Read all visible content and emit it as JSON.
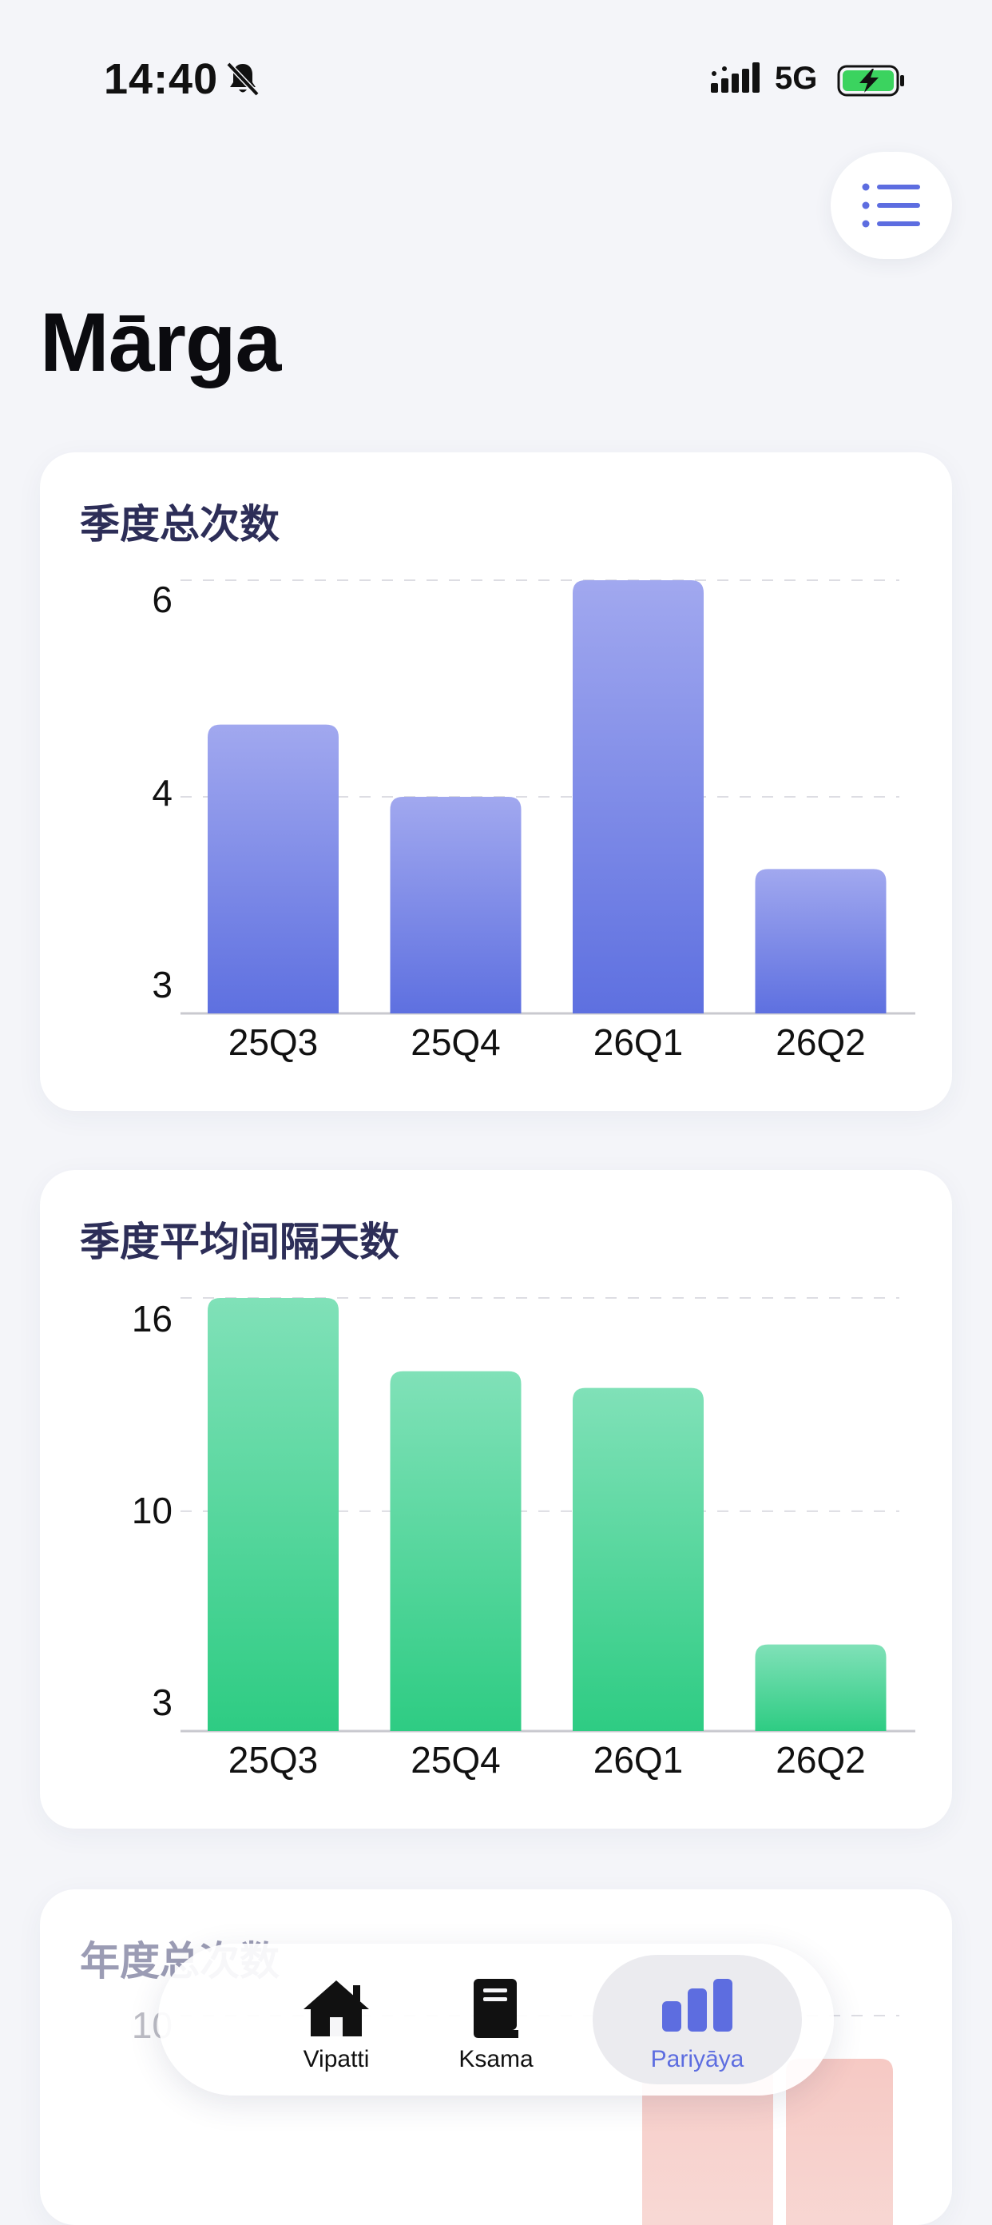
{
  "status_bar": {
    "time": "14:40",
    "network": "5G",
    "bell_icon": "bell-slash-icon",
    "signal_icon": "cellular-signal-icon",
    "battery_icon": "battery-charging-icon"
  },
  "header": {
    "menu_icon": "list-icon",
    "title": "Mārga"
  },
  "colors": {
    "accent": "#5d6de0",
    "purple_top": "#a1a8ef",
    "purple_bottom": "#5e70e0",
    "green_top": "#80e1b8",
    "green_bottom": "#2ecc83",
    "red_faint": "#f6c9c4"
  },
  "cards": [
    {
      "title": "季度总次数"
    },
    {
      "title": "季度平均间隔天数"
    },
    {
      "title": "年度总次数"
    }
  ],
  "chart_data": [
    {
      "type": "bar",
      "title": "季度总次数",
      "categories": [
        "25Q3",
        "25Q4",
        "26Q1",
        "26Q2"
      ],
      "values": [
        5,
        4.5,
        6,
        4
      ],
      "y_ticks": [
        "6",
        "4",
        "3"
      ],
      "y_tick_values": [
        6,
        4,
        3
      ],
      "ylim": [
        3,
        6
      ],
      "grid": "dashed horizontal",
      "color": "purple gradient"
    },
    {
      "type": "bar",
      "title": "季度平均间隔天数",
      "categories": [
        "25Q3",
        "25Q4",
        "26Q1",
        "26Q2"
      ],
      "values": [
        16,
        13.8,
        13.3,
        5.6
      ],
      "y_ticks": [
        "16",
        "10",
        "3"
      ],
      "y_tick_values": [
        16,
        10,
        3
      ],
      "ylim": [
        3,
        16
      ],
      "grid": "dashed horizontal",
      "color": "green gradient"
    },
    {
      "type": "bar",
      "title": "年度总次数",
      "y_ticks": [
        "10"
      ],
      "color": "red gradient",
      "note": "partially visible"
    }
  ],
  "tabbar": {
    "tabs": [
      {
        "label": "Vipatti",
        "icon": "house-icon",
        "active": false
      },
      {
        "label": "Ksama",
        "icon": "book-icon",
        "active": false
      },
      {
        "label": "Pariyāya",
        "icon": "bar-chart-icon",
        "active": true
      }
    ]
  }
}
